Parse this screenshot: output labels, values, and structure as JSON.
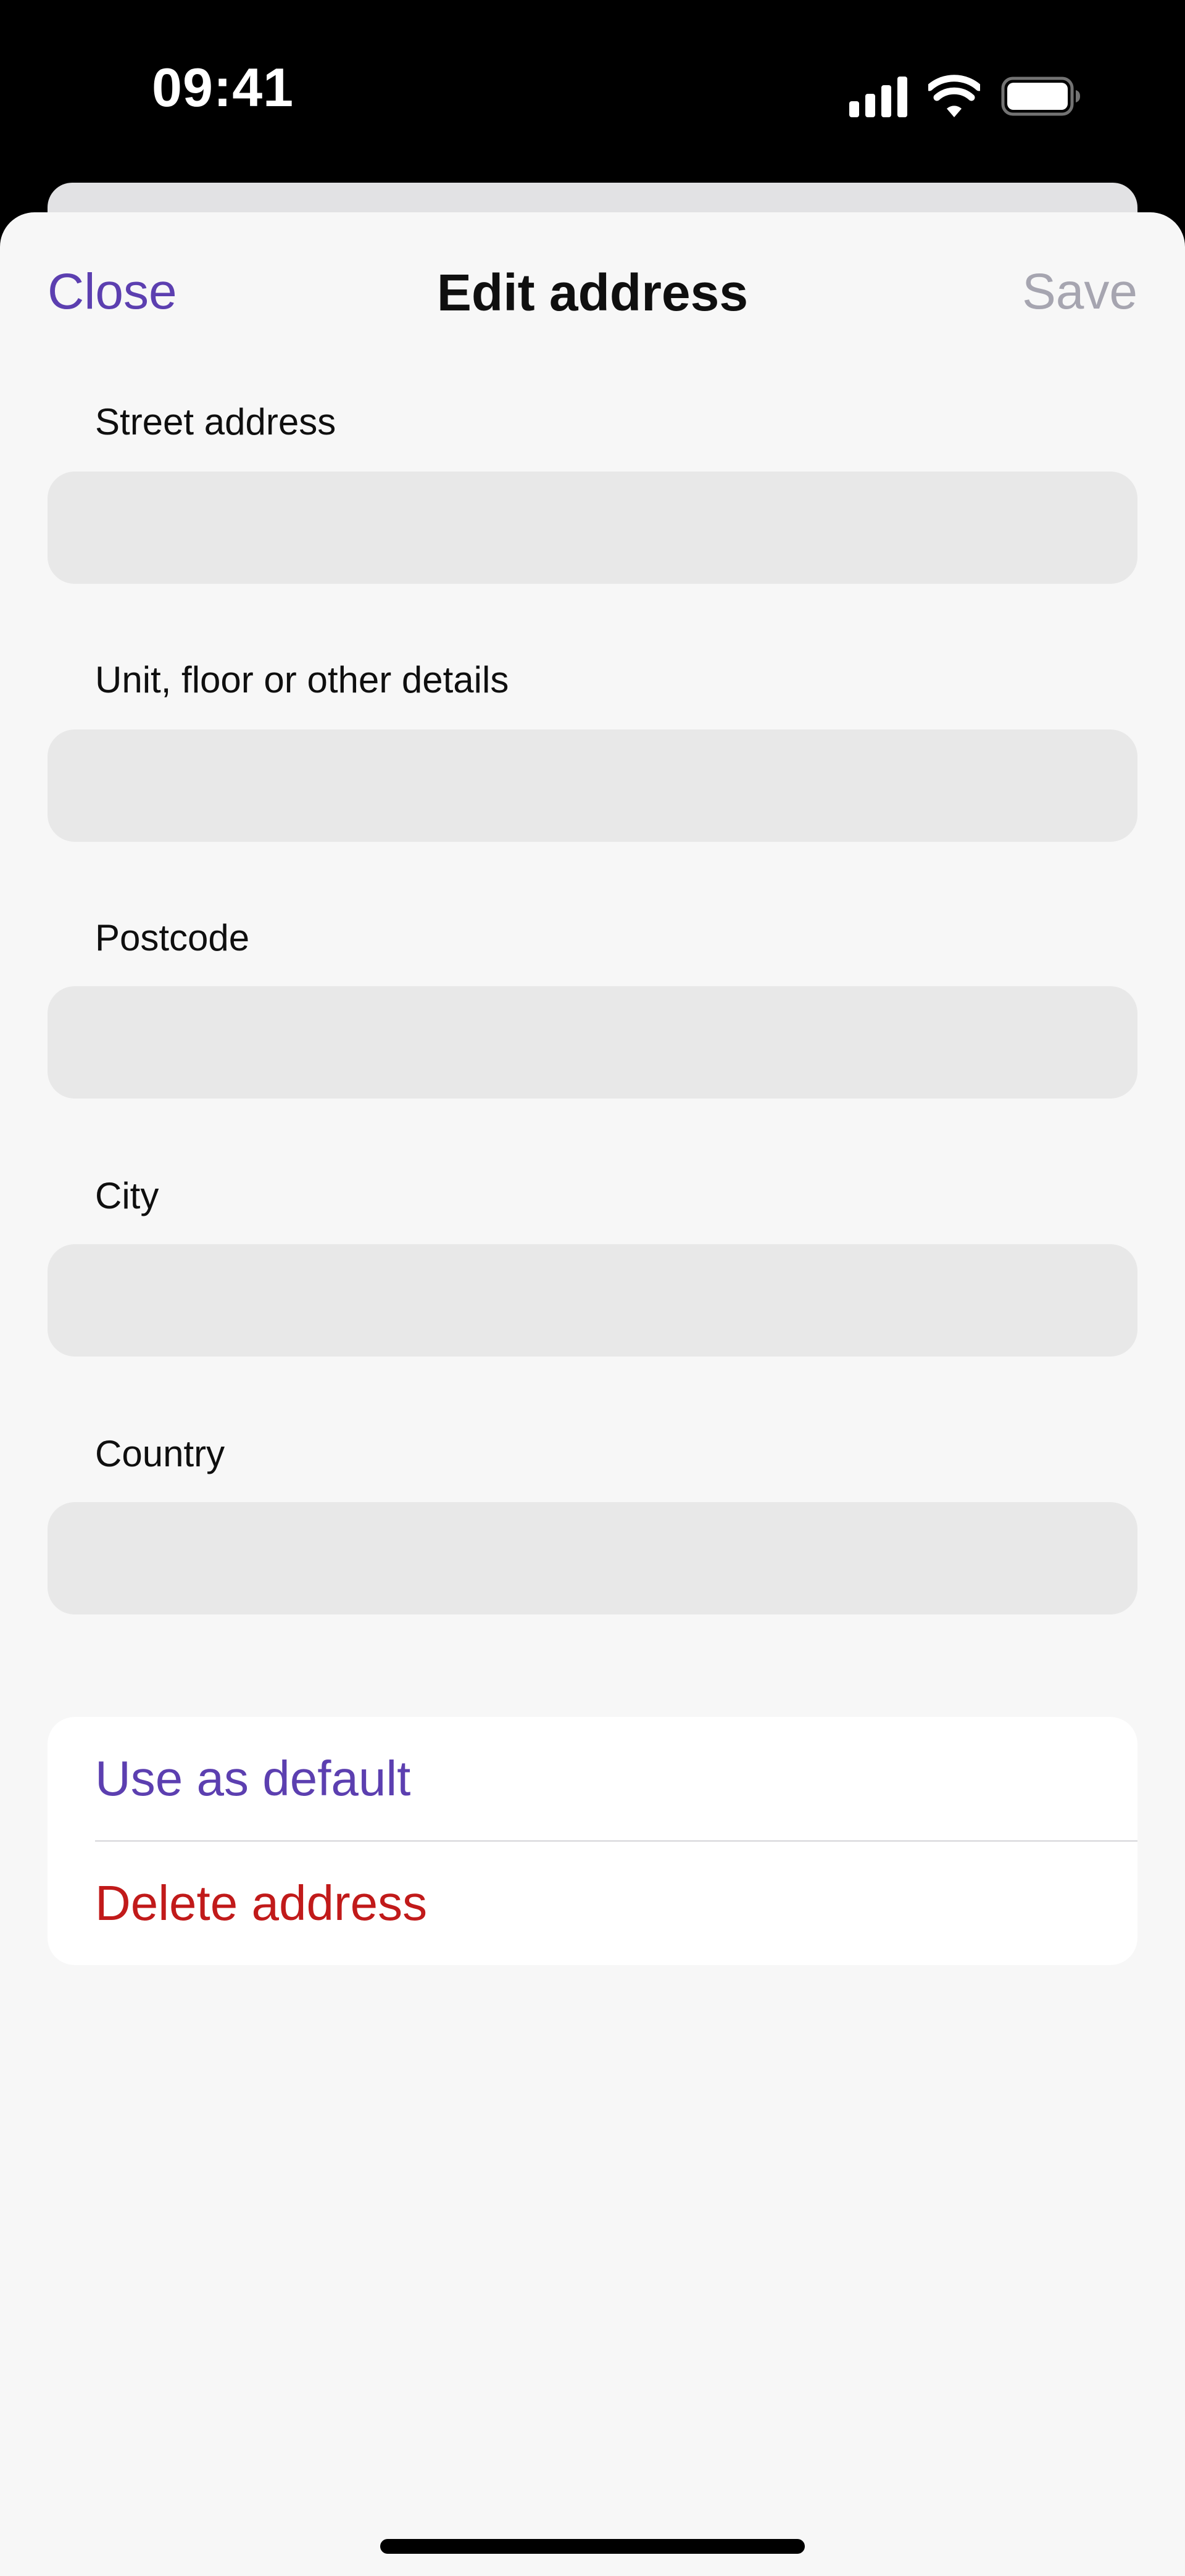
{
  "status_bar": {
    "time": "09:41"
  },
  "nav": {
    "close_label": "Close",
    "title": "Edit address",
    "save_label": "Save"
  },
  "form": {
    "fields": [
      {
        "label": "Street address",
        "value": ""
      },
      {
        "label": "Unit, floor or other details",
        "value": ""
      },
      {
        "label": "Postcode",
        "value": ""
      },
      {
        "label": "City",
        "value": ""
      },
      {
        "label": "Country",
        "value": ""
      }
    ]
  },
  "actions": {
    "use_default_label": "Use as default",
    "delete_label": "Delete address"
  },
  "colors": {
    "accent": "#5c3fb0",
    "destructive": "#c11a1a",
    "disabled": "#a6a5b0",
    "sheet_background": "#f7f7f7",
    "field_background": "#e8e8e8"
  }
}
